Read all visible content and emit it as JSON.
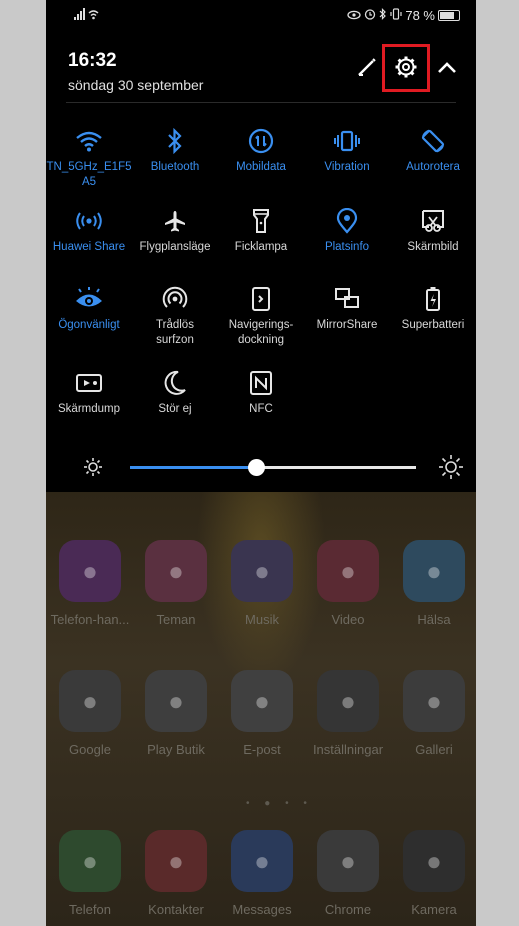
{
  "status": {
    "battery": "78 %"
  },
  "header": {
    "time": "16:32",
    "date": "söndag 30 september"
  },
  "tiles": [
    {
      "label": "TN_5GHz_E1F5\nA5",
      "icon": "wifi-icon",
      "state": "on"
    },
    {
      "label": "Bluetooth",
      "icon": "bluetooth-icon",
      "state": "on"
    },
    {
      "label": "Mobildata",
      "icon": "mobile-data-icon",
      "state": "on"
    },
    {
      "label": "Vibration",
      "icon": "vibration-icon",
      "state": "on"
    },
    {
      "label": "Autorotera",
      "icon": "autorotate-icon",
      "state": "on"
    },
    {
      "label": "Huawei Share",
      "icon": "huawei-share-icon",
      "state": "on"
    },
    {
      "label": "Flygplansläge",
      "icon": "airplane-icon",
      "state": "off"
    },
    {
      "label": "Ficklampa",
      "icon": "flashlight-icon",
      "state": "off"
    },
    {
      "label": "Platsinfo",
      "icon": "location-icon",
      "state": "on"
    },
    {
      "label": "Skärmbild",
      "icon": "screenshot-icon",
      "state": "off"
    },
    {
      "label": "Ögonvänligt",
      "icon": "eye-comfort-icon",
      "state": "on"
    },
    {
      "label": "Trådlös\nsurfzon",
      "icon": "hotspot-icon",
      "state": "off"
    },
    {
      "label": "Navigerings-\ndockning",
      "icon": "navigation-dock-icon",
      "state": "off"
    },
    {
      "label": "MirrorShare",
      "icon": "mirrorshare-icon",
      "state": "off"
    },
    {
      "label": "Superbatteri",
      "icon": "super-battery-icon",
      "state": "off"
    },
    {
      "label": "Skärmdump",
      "icon": "screen-record-icon",
      "state": "off"
    },
    {
      "label": "Stör ej",
      "icon": "moon-icon",
      "state": "off"
    },
    {
      "label": "NFC",
      "icon": "nfc-icon",
      "state": "off"
    }
  ],
  "brightness": {
    "level": 0.44
  },
  "apps": [
    {
      "label": "Telefon-han...",
      "color": "#4a2a55"
    },
    {
      "label": "Teman",
      "color": "#5a3040"
    },
    {
      "label": "Musik",
      "color": "#3a3550"
    },
    {
      "label": "Video",
      "color": "#5a2a33"
    },
    {
      "label": "Hälsa",
      "color": "#2e4a5e"
    },
    {
      "label": "Google",
      "color": "#3a3a3a"
    },
    {
      "label": "Play Butik",
      "color": "#3e3e3e"
    },
    {
      "label": "E-post",
      "color": "#404040"
    },
    {
      "label": "Inställningar",
      "color": "#353535"
    },
    {
      "label": "Galleri",
      "color": "#3c3c3c"
    },
    {
      "label": "Telefon",
      "color": "#2e4a2e"
    },
    {
      "label": "Kontakter",
      "color": "#5a2a2a"
    },
    {
      "label": "Messages",
      "color": "#2a3a5a"
    },
    {
      "label": "Chrome",
      "color": "#3a3a3a"
    },
    {
      "label": "Kamera",
      "color": "#2e2e2e"
    }
  ],
  "colors": {
    "accent": "#3a8ff0",
    "highlight": "#e01b22"
  }
}
